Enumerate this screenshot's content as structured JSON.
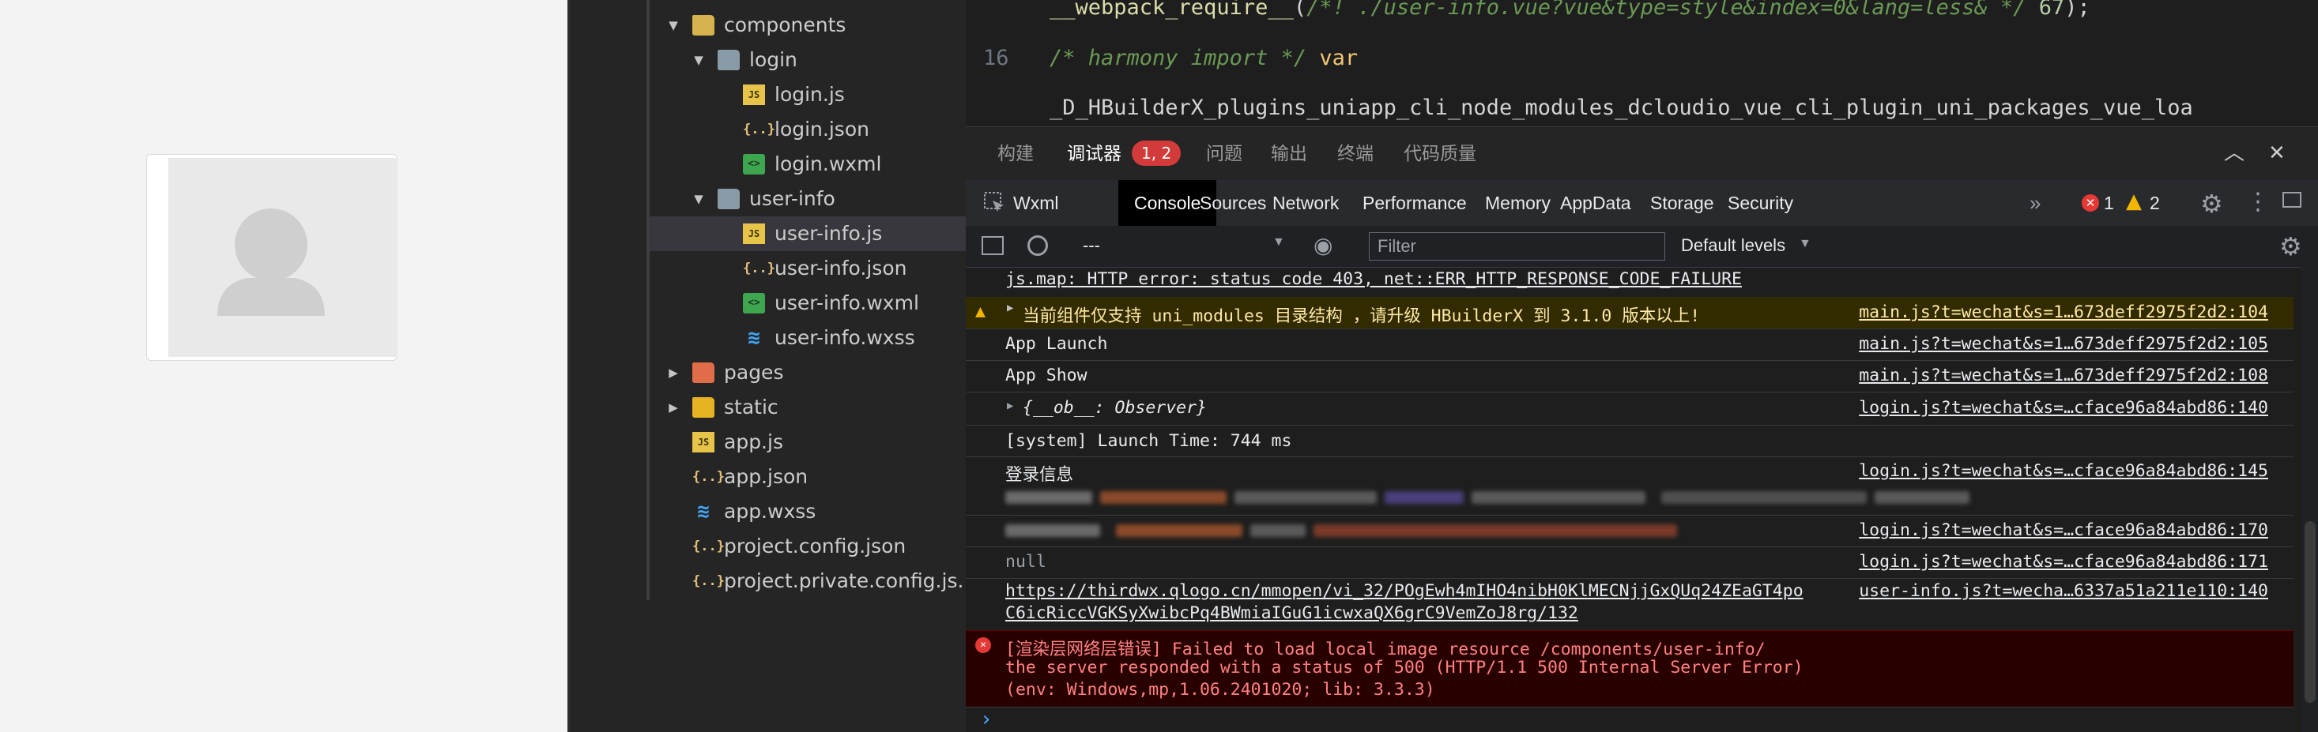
{
  "tree": [
    {
      "label": "components",
      "icon": "folder-components-icon",
      "expanded": true,
      "indent": 1
    },
    {
      "label": "login",
      "icon": "folder-icon",
      "expanded": true,
      "indent": 2
    },
    {
      "label": "login.js",
      "icon": "js-file-icon",
      "indent": 3
    },
    {
      "label": "login.json",
      "icon": "json-file-icon",
      "indent": 3
    },
    {
      "label": "login.wxml",
      "icon": "wxml-file-icon",
      "indent": 3
    },
    {
      "label": "user-info",
      "icon": "folder-icon",
      "expanded": true,
      "indent": 2
    },
    {
      "label": "user-info.js",
      "icon": "js-file-icon",
      "indent": 3,
      "selected": true
    },
    {
      "label": "user-info.json",
      "icon": "json-file-icon",
      "indent": 3
    },
    {
      "label": "user-info.wxml",
      "icon": "wxml-file-icon",
      "indent": 3
    },
    {
      "label": "user-info.wxss",
      "icon": "wxss-file-icon",
      "indent": 3
    },
    {
      "label": "pages",
      "icon": "folder-pages-icon",
      "expanded": false,
      "indent": 1
    },
    {
      "label": "static",
      "icon": "folder-static-icon",
      "expanded": false,
      "indent": 1
    },
    {
      "label": "app.js",
      "icon": "js-file-icon",
      "indent": 1
    },
    {
      "label": "app.json",
      "icon": "json-file-icon",
      "indent": 1
    },
    {
      "label": "app.wxss",
      "icon": "wxss-file-icon",
      "indent": 1
    },
    {
      "label": "project.config.json",
      "icon": "json-file-icon",
      "indent": 1
    },
    {
      "label": "project.private.config.js...",
      "icon": "json-file-icon",
      "indent": 1
    }
  ],
  "editor": {
    "line1_fn": "__webpack_require__",
    "line1_paren": "(",
    "line1_comment": "/*! ./user-info.vue?vue&type=style&index=0&lang=less& */",
    "line1_num": "67",
    "line1_end": ");",
    "line2_no": "16",
    "line2_comment": "/* harmony import */",
    "line2_kw": "var",
    "line3_text": "_D_HBuilderX_plugins_uniapp_cli_node_modules_dcloudio_vue_cli_plugin_uni_packages_vue_loa"
  },
  "panel_tabs": {
    "build": "构建",
    "debugger": "调试器",
    "debugger_badge": "1, 2",
    "issues": "问题",
    "output": "输出",
    "terminal": "终端",
    "quality": "代码质量"
  },
  "devtools_tabs": [
    "Wxml",
    "Console",
    "Sources",
    "Network",
    "Performance",
    "Memory",
    "AppData",
    "Storage",
    "Security"
  ],
  "devtools_more": "»",
  "devtools_error_count": "1",
  "devtools_warning_count": "2",
  "console_toolbar": {
    "context": "---",
    "filter_placeholder": "Filter",
    "levels": "Default levels"
  },
  "console": {
    "row0_msg": "js.map: HTTP error: status code 403, net::ERR_HTTP_RESPONSE_CODE_FAILURE",
    "row1_msg": "当前组件仅支持 uni_modules 目录结构 ，请升级 HBuilderX 到 3.1.0 版本以上!",
    "row1_src": "main.js?t=wechat&s=1…673deff2975f2d2:104",
    "row2_msg": "App Launch",
    "row2_src": "main.js?t=wechat&s=1…673deff2975f2d2:105",
    "row3_msg": "App Show",
    "row3_src": "main.js?t=wechat&s=1…673deff2975f2d2:108",
    "row4_msg": "{__ob__: Observer}",
    "row4_src": "login.js?t=wechat&s=…cface96a84abd86:140",
    "row5_msg": "[system] Launch Time: 744 ms",
    "row6_msg": "登录信息",
    "row6_src": "login.js?t=wechat&s=…cface96a84abd86:145",
    "row7_src": "login.js?t=wechat&s=…cface96a84abd86:170",
    "row8_msg": "null",
    "row8_src": "login.js?t=wechat&s=…cface96a84abd86:171",
    "row9_line1": "https://thirdwx.qlogo.cn/mmopen/vi_32/POgEwh4mIHO4nibH0KlMECNjjGxQUq24ZEaGT4po",
    "row9_line2": "C6icRiccVGKSyXwibcPq4BWmiaIGuG1icwxaQX6grC9VemZoJ8rg/132",
    "row9_src": "user-info.js?t=wecha…6337a51a211e110:140",
    "err_line1": "[渲染层网络层错误] Failed to load local image resource /components/user-info/",
    "err_line2": " the server responded with a status of 500 (HTTP/1.1 500 Internal Server Error)",
    "err_line3": "(env: Windows,mp,1.06.2401020; lib: 3.3.3)",
    "prompt": "›"
  }
}
